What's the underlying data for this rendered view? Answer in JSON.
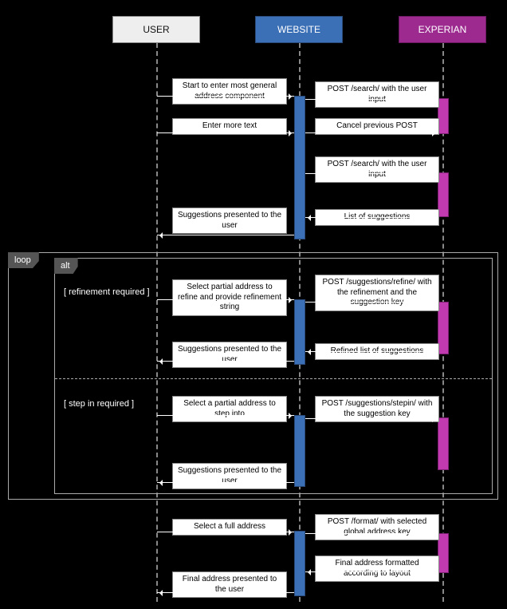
{
  "participants": {
    "user": "USER",
    "website": "WEBSITE",
    "experian": "EXPERIAN"
  },
  "fragments": {
    "loop": "loop",
    "alt": "alt",
    "guard_refine": "[ refinement required ]",
    "guard_stepin": "[ step in required ]"
  },
  "messages": {
    "m1": "Start to enter most general address component",
    "m2": "POST /search/ with the user input",
    "m3": "Enter more text",
    "m4": "Cancel previous POST",
    "m5": "POST /search/ with the user input",
    "m6": "List of suggestions",
    "m7": "Suggestions presented to the user",
    "m8": "Select partial address to refine and provide refinement string",
    "m9": "POST /suggestions/refine/ with the refinement and the suggestion key",
    "m10": "Refined list of suggestions",
    "m11": "Suggestions presented to the user",
    "m12": "Select a partial address to step into",
    "m13": "POST /suggestions/stepin/ with the suggestion key",
    "m14": "Suggestions presented to the user",
    "m15": "Select a full address",
    "m16": "POST /format/ with selected global address key",
    "m17": "Final address formatted according to layout",
    "m18": "Final address presented to the user"
  },
  "chart_data": {
    "type": "table",
    "diagram": "UML sequence",
    "participants": [
      "USER",
      "WEBSITE",
      "EXPERIAN"
    ],
    "fragments": [
      {
        "kind": "loop",
        "contains": [
          {
            "kind": "alt",
            "branches": [
              {
                "guard": "refinement required",
                "messages": [
                  8,
                  9,
                  10,
                  11
                ]
              },
              {
                "guard": "step in required",
                "messages": [
                  12,
                  13,
                  14
                ]
              }
            ]
          }
        ]
      }
    ],
    "messages": [
      {
        "n": 1,
        "from": "USER",
        "to": "WEBSITE",
        "text": "Start to enter most general address component",
        "kind": "sync"
      },
      {
        "n": 2,
        "from": "WEBSITE",
        "to": "EXPERIAN",
        "text": "POST /search/ with the user input",
        "kind": "sync"
      },
      {
        "n": 3,
        "from": "USER",
        "to": "WEBSITE",
        "text": "Enter more text",
        "kind": "sync"
      },
      {
        "n": 4,
        "from": "WEBSITE",
        "to": "EXPERIAN",
        "text": "Cancel previous POST",
        "kind": "sync"
      },
      {
        "n": 5,
        "from": "WEBSITE",
        "to": "EXPERIAN",
        "text": "POST /search/ with the user input",
        "kind": "sync"
      },
      {
        "n": 6,
        "from": "EXPERIAN",
        "to": "WEBSITE",
        "text": "List of suggestions",
        "kind": "return"
      },
      {
        "n": 7,
        "from": "WEBSITE",
        "to": "USER",
        "text": "Suggestions presented to the user",
        "kind": "return"
      },
      {
        "n": 8,
        "from": "USER",
        "to": "WEBSITE",
        "text": "Select partial address to refine and provide refinement string",
        "kind": "sync"
      },
      {
        "n": 9,
        "from": "WEBSITE",
        "to": "EXPERIAN",
        "text": "POST /suggestions/refine/ with the refinement and the suggestion key",
        "kind": "sync"
      },
      {
        "n": 10,
        "from": "EXPERIAN",
        "to": "WEBSITE",
        "text": "Refined list of suggestions",
        "kind": "return"
      },
      {
        "n": 11,
        "from": "WEBSITE",
        "to": "USER",
        "text": "Suggestions presented to the user",
        "kind": "return"
      },
      {
        "n": 12,
        "from": "USER",
        "to": "WEBSITE",
        "text": "Select a partial address to step into",
        "kind": "sync"
      },
      {
        "n": 13,
        "from": "WEBSITE",
        "to": "EXPERIAN",
        "text": "POST /suggestions/stepin/ with the suggestion key",
        "kind": "sync"
      },
      {
        "n": 14,
        "from": "WEBSITE",
        "to": "USER",
        "text": "Suggestions presented to the user",
        "kind": "return"
      },
      {
        "n": 15,
        "from": "USER",
        "to": "WEBSITE",
        "text": "Select a full address",
        "kind": "sync"
      },
      {
        "n": 16,
        "from": "WEBSITE",
        "to": "EXPERIAN",
        "text": "POST /format/ with selected global address key",
        "kind": "sync"
      },
      {
        "n": 17,
        "from": "EXPERIAN",
        "to": "WEBSITE",
        "text": "Final address formatted according to layout",
        "kind": "return"
      },
      {
        "n": 18,
        "from": "WEBSITE",
        "to": "USER",
        "text": "Final address presented to the user",
        "kind": "return"
      }
    ]
  }
}
